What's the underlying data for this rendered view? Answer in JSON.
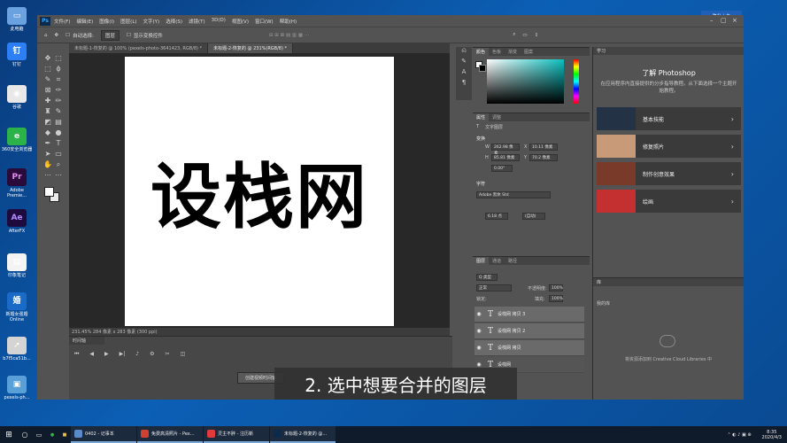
{
  "desktop": {
    "icons": [
      {
        "label": "此电脑",
        "color": "#6aa2e0",
        "glyph": "▭"
      },
      {
        "label": "钉钉",
        "color": "#2c7ff5",
        "glyph": "钉"
      },
      {
        "label": "谷歌",
        "color": "#e8e8e8",
        "glyph": "◉"
      },
      {
        "label": "360安全浏览器",
        "color": "#2bb34a",
        "glyph": "e"
      },
      {
        "label": "Adobe Premie...",
        "color": "#2a0a3a",
        "glyph": "Pr"
      },
      {
        "label": "AfterFX",
        "color": "#1e0a3c",
        "glyph": "Ae"
      },
      {
        "label": "印象笔记",
        "color": "#f4f4f4",
        "glyph": "▤"
      },
      {
        "label": "新婚女强婚 Online",
        "color": "#1a6ac8",
        "glyph": "婚"
      },
      {
        "label": "b7f5ca51b...",
        "color": "#d4d4d4",
        "glyph": "➚"
      },
      {
        "label": "pexels-ph...",
        "color": "#5aa0d8",
        "glyph": "▣"
      }
    ],
    "top_badge": "隐私上传"
  },
  "photoshop": {
    "logo": "Ps",
    "menu": [
      "文件(F)",
      "编辑(E)",
      "图像(I)",
      "图层(L)",
      "文字(Y)",
      "选择(S)",
      "滤镜(T)",
      "3D(D)",
      "视图(V)",
      "窗口(W)",
      "帮助(H)"
    ],
    "options": {
      "auto_select": "自动选择:",
      "layer_select": "图层",
      "show_transform": "显示变换控件"
    },
    "doc_tabs": [
      {
        "label": "未标题-1-恢复的 @ 100% (pexels-photo-3641423, RGB/8) *",
        "active": false
      },
      {
        "label": "未标题-2-恢复的 @ 231%(RGB/8) *",
        "active": true
      }
    ],
    "canvas_text": "设栈网",
    "status": "231.45%   284 像素 x 283 像素 (300 ppi)",
    "timeline": {
      "title": "时间轴",
      "create_button": "创建视频时间轴"
    },
    "color_panel": {
      "tabs": [
        "颜色",
        "色板",
        "渐变",
        "图案"
      ]
    },
    "properties": {
      "tabs": [
        "属性",
        "调整"
      ],
      "kind": "文字图层",
      "transform_title": "变换",
      "w": "262.98 像素",
      "x": "10.11 像素",
      "h": "85.81 像素",
      "y": "70.2 像素",
      "angle": "0.00°",
      "char_title": "字符",
      "font": "Adobe 黑体 Std",
      "size": "6.18 点",
      "leading": "(自动)"
    },
    "layers": {
      "tabs": [
        "图层",
        "通道",
        "路径"
      ],
      "kind_filter": "Q 类型",
      "blend_mode": "正常",
      "opacity_label": "不透明度:",
      "opacity_value": "100%",
      "lock_label": "锁定:",
      "fill_label": "填充:",
      "fill_value": "100%",
      "items": [
        "设栈网 拷贝 3",
        "设栈网 拷贝 2",
        "设栈网 拷贝",
        "设栈网"
      ]
    },
    "learn": {
      "tab": "学习",
      "title": "了解 Photoshop",
      "subtitle": "在应用程序内直接提供的分步指导教程。从下面选择一个主题开始教程。",
      "cards": [
        {
          "label": "基本技能",
          "thumb": "#233245"
        },
        {
          "label": "修复照片",
          "thumb": "#c89a78"
        },
        {
          "label": "制作创意效果",
          "thumb": "#7a3a2a"
        },
        {
          "label": "绘画",
          "thumb": "#c43030"
        }
      ]
    },
    "libraries": {
      "tab": "库",
      "dropdown": "我的库",
      "note": "将资源添加到 Creative Cloud Libraries 中"
    }
  },
  "caption": "2. 选中想要合并的图层",
  "taskbar": {
    "apps": [
      {
        "label": "0402 - 记事本",
        "color": "#5a8ac8"
      },
      {
        "label": "免费高清照片 - Pex...",
        "color": "#d04030"
      },
      {
        "label": "灵主不胖 - 注历新",
        "color": "#e03a3a"
      },
      {
        "label": "未标题-2-恢复的 @...",
        "color": "#0c2a4c"
      }
    ],
    "time": "8:35",
    "date": "2020/4/3"
  }
}
